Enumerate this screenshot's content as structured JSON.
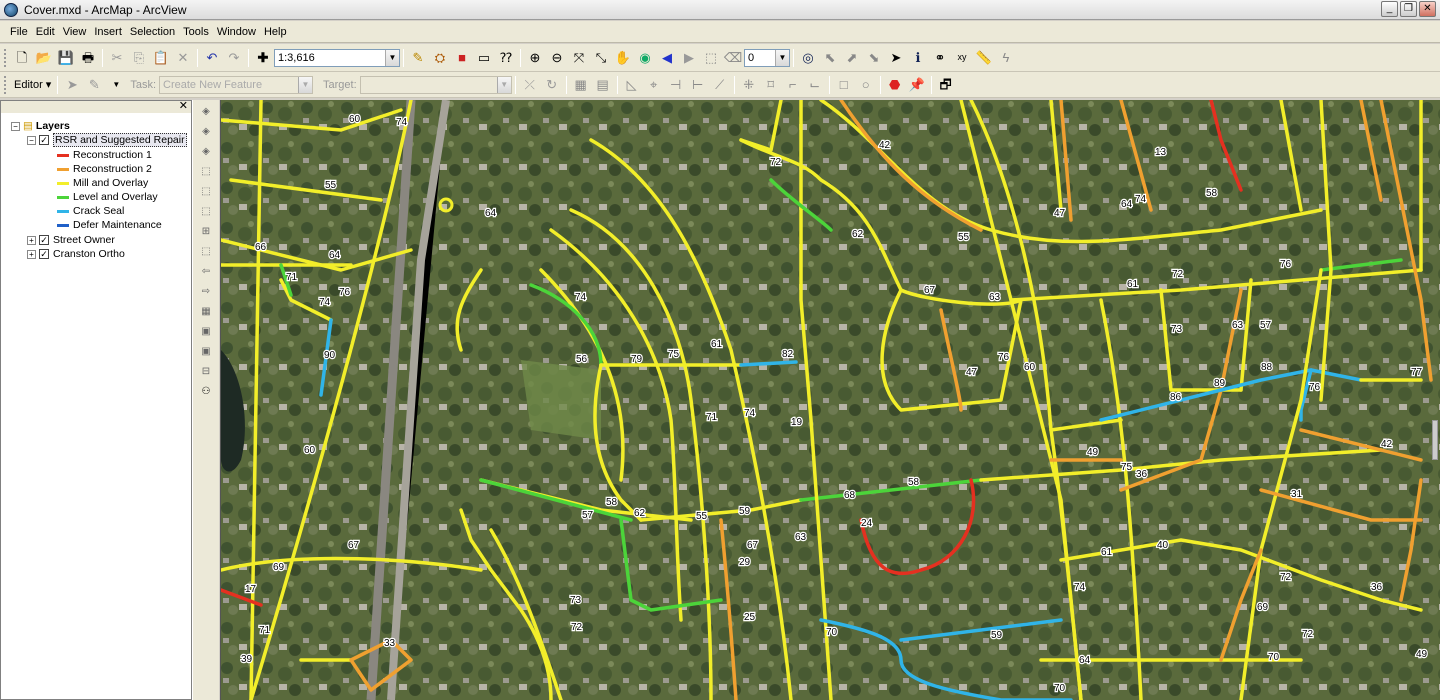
{
  "window": {
    "title": "Cover.mxd - ArcMap - ArcView",
    "minimize": "_",
    "maximize": "❐",
    "close": "✕"
  },
  "menu": [
    "File",
    "Edit",
    "View",
    "Insert",
    "Selection",
    "Tools",
    "Window",
    "Help"
  ],
  "toolbar": {
    "scale_value": "1:3,616",
    "rotation_value": "0",
    "editor_label": "Editor ▾",
    "task_label": "Task:",
    "task_value": "Create New Feature",
    "target_label": "Target:",
    "target_value": ""
  },
  "toc": {
    "root_label": "Layers",
    "layers": [
      {
        "label": "RSR and Suggested Repair",
        "checked": true,
        "expanded": true
      },
      {
        "label": "Street Owner",
        "checked": true,
        "expanded": false
      },
      {
        "label": "Cranston Ortho",
        "checked": true,
        "expanded": false
      }
    ],
    "legend": [
      {
        "label": "Reconstruction 1",
        "color": "#e53020"
      },
      {
        "label": "Reconstruction 2",
        "color": "#f0a030"
      },
      {
        "label": "Mill and Overlay",
        "color": "#f2ee2a"
      },
      {
        "label": "Level and Overlay",
        "color": "#4cd43a"
      },
      {
        "label": "Crack Seal",
        "color": "#30b4e8"
      },
      {
        "label": "Defer Maintenance",
        "color": "#2060c8"
      }
    ]
  },
  "map": {
    "road_labels": [
      "60",
      "74",
      "55",
      "64",
      "66",
      "71",
      "74",
      "76",
      "90",
      "60",
      "67",
      "69",
      "17",
      "71",
      "39",
      "64",
      "74",
      "56",
      "79",
      "75",
      "82",
      "61",
      "71",
      "74",
      "57",
      "58",
      "62",
      "55",
      "59",
      "67",
      "72",
      "42",
      "62",
      "67",
      "63",
      "55",
      "76",
      "60",
      "19",
      "68",
      "58",
      "24",
      "29",
      "25",
      "63",
      "70",
      "73",
      "72",
      "13",
      "58",
      "64",
      "47",
      "74",
      "76",
      "61",
      "72",
      "73",
      "63",
      "57",
      "47",
      "49",
      "75",
      "36",
      "86",
      "89",
      "88",
      "76",
      "77",
      "42",
      "31",
      "61",
      "40",
      "36",
      "72",
      "69",
      "70",
      "64",
      "74",
      "72",
      "49",
      "33",
      "70",
      "59"
    ]
  }
}
